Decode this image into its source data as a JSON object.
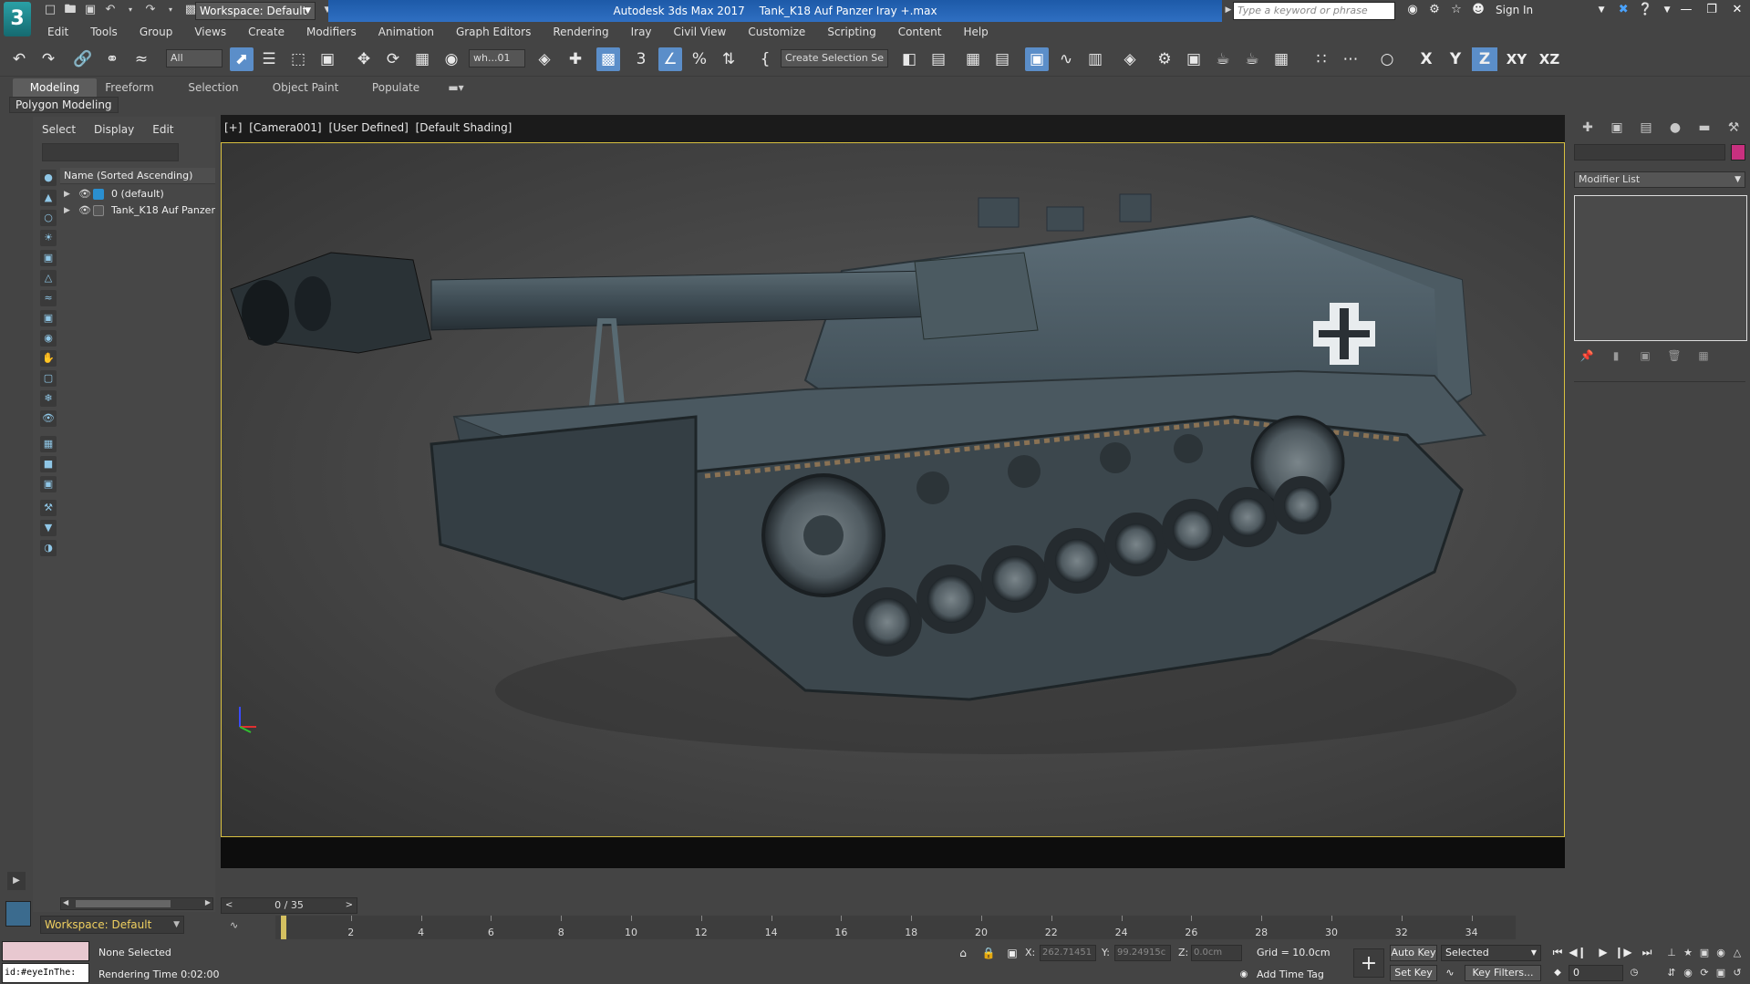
{
  "app": {
    "logo": "3",
    "title": "Autodesk 3ds Max 2017",
    "file": "Tank_K18 Auf Panzer Iray +.max",
    "workspace": "Workspace: Default",
    "search_placeholder": "Type a keyword or phrase",
    "sign_in": "Sign In"
  },
  "menu": [
    "Edit",
    "Tools",
    "Group",
    "Views",
    "Create",
    "Modifiers",
    "Animation",
    "Graph Editors",
    "Rendering",
    "Iray",
    "Civil View",
    "Customize",
    "Scripting",
    "Content",
    "Help"
  ],
  "toolbar": {
    "filter": "All",
    "view_ref": "wh...01",
    "selection_set": "Create Selection Se",
    "axes": [
      "X",
      "Y",
      "Z",
      "XY",
      "XZ"
    ],
    "active_axis": "Z"
  },
  "ribbon": {
    "tabs": [
      "Modeling",
      "Freeform",
      "Selection",
      "Object Paint",
      "Populate"
    ],
    "active_tab": "Modeling",
    "sub_label": "Polygon Modeling"
  },
  "explorer": {
    "menu": [
      "Select",
      "Display",
      "Edit"
    ],
    "column_header": "Name (Sorted Ascending)",
    "rows": [
      {
        "name": "0 (default)",
        "type": "layer"
      },
      {
        "name": "Tank_K18 Auf Panzer",
        "type": "object"
      }
    ]
  },
  "viewport": {
    "labels": [
      "[+]",
      "[Camera001]",
      "[User Defined]",
      "[Default Shading]"
    ]
  },
  "timeline": {
    "current_frame": "0 / 35",
    "ticks": [
      "2",
      "4",
      "6",
      "8",
      "10",
      "12",
      "14",
      "16",
      "18",
      "20",
      "22",
      "24",
      "26",
      "28",
      "30",
      "32",
      "34"
    ]
  },
  "status": {
    "selection": "None Selected",
    "render_time": "Rendering Time  0:02:00",
    "maxscript": "id:#eyeInThe:",
    "x_label": "X:",
    "x_value": "262.71451",
    "y_label": "Y:",
    "y_value": "99.24915c",
    "z_label": "Z:",
    "z_value": "0.0cm",
    "grid": "Grid = 10.0cm",
    "add_time_tag": "Add Time Tag",
    "auto_key": "Auto Key",
    "set_key": "Set Key",
    "key_mode": "Selected",
    "key_filters": "Key Filters...",
    "frame_field": "0"
  },
  "command_panel": {
    "modifier_list": "Modifier List",
    "object_color": "#c8307f"
  }
}
